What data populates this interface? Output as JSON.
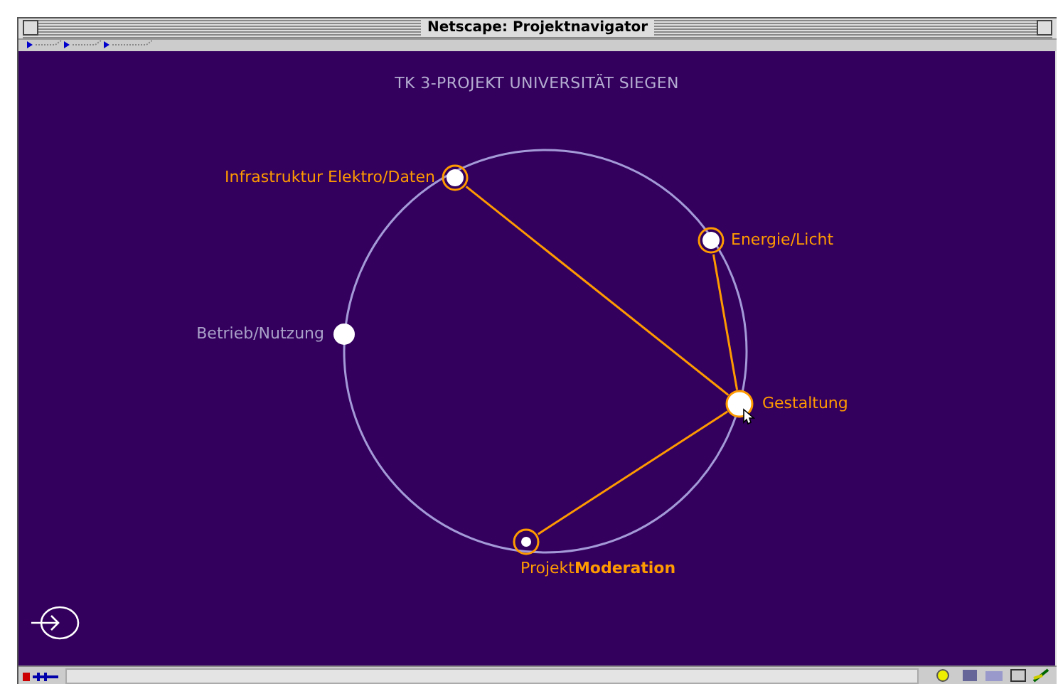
{
  "window": {
    "title": "Netscape: Projektnavigator"
  },
  "page": {
    "heading": "TK 3-PROJEKT UNIVERSITÄT SIEGEN"
  },
  "diagram": {
    "nodes": [
      {
        "label": "Infrastruktur Elektro/Daten",
        "active": true,
        "selected": false,
        "linked": true
      },
      {
        "label": "Energie/Licht",
        "active": true,
        "selected": false,
        "linked": true
      },
      {
        "label": "Betrieb/Nutzung",
        "active": false,
        "selected": false,
        "linked": false
      },
      {
        "label": "Gestaltung",
        "active": true,
        "selected": true,
        "linked": false
      },
      {
        "label": "Projekt**Moderation**",
        "active": true,
        "selected": false,
        "linked": true
      }
    ]
  }
}
